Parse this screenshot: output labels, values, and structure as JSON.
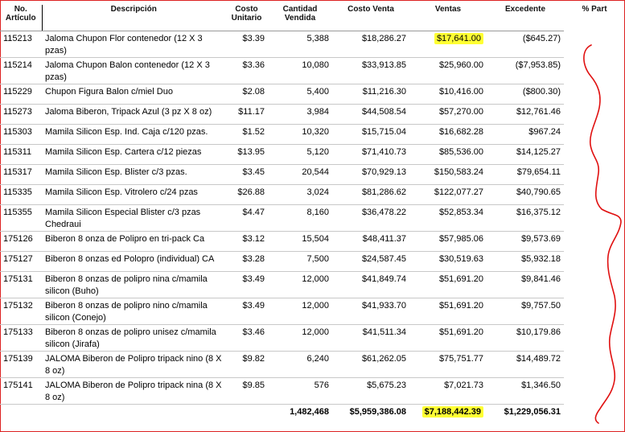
{
  "columns": {
    "no_articulo": "No. Artículo",
    "descripcion": "Descripción",
    "costo_unitario": "Costo Unitario",
    "cantidad_vendida": "Cantidad Vendida",
    "costo_venta": "Costo Venta",
    "ventas": "Ventas",
    "excedente": "Excedente",
    "pct_part": "% Part"
  },
  "rows": [
    {
      "code": "115213",
      "desc": "Jaloma Chupon Flor contenedor (12 X 3 pzas)",
      "unit": "$3.39",
      "qty": "5,388",
      "cost": "$18,286.27",
      "sales": "$17,641.00",
      "excess": "($645.27)",
      "highlight": true
    },
    {
      "code": "115214",
      "desc": "Jaloma Chupon Balon contenedor (12 X 3 pzas)",
      "unit": "$3.36",
      "qty": "10,080",
      "cost": "$33,913.85",
      "sales": "$25,960.00",
      "excess": "($7,953.85)"
    },
    {
      "code": "115229",
      "desc": "Chupon Figura Balon c/miel Duo",
      "unit": "$2.08",
      "qty": "5,400",
      "cost": "$11,216.30",
      "sales": "$10,416.00",
      "excess": "($800.30)"
    },
    {
      "code": "115273",
      "desc": "Jaloma Biberon, Tripack Azul (3 pz X 8 oz)",
      "unit": "$11.17",
      "qty": "3,984",
      "cost": "$44,508.54",
      "sales": "$57,270.00",
      "excess": "$12,761.46"
    },
    {
      "code": "115303",
      "desc": "Mamila Silicon Esp. Ind. Caja c/120 pzas.",
      "unit": "$1.52",
      "qty": "10,320",
      "cost": "$15,715.04",
      "sales": "$16,682.28",
      "excess": "$967.24"
    },
    {
      "code": "115311",
      "desc": "Mamila Silicon Esp. Cartera c/12 piezas",
      "unit": "$13.95",
      "qty": "5,120",
      "cost": "$71,410.73",
      "sales": "$85,536.00",
      "excess": "$14,125.27"
    },
    {
      "code": "115317",
      "desc": "Mamila Silicon Esp. Blister c/3 pzas.",
      "unit": "$3.45",
      "qty": "20,544",
      "cost": "$70,929.13",
      "sales": "$150,583.24",
      "excess": "$79,654.11"
    },
    {
      "code": "115335",
      "desc": "Mamila Silicon Esp. Vitrolero c/24 pzas",
      "unit": "$26.88",
      "qty": "3,024",
      "cost": "$81,286.62",
      "sales": "$122,077.27",
      "excess": "$40,790.65"
    },
    {
      "code": "115355",
      "desc": "Mamila Silicon Especial Blister c/3 pzas Chedraui",
      "unit": "$4.47",
      "qty": "8,160",
      "cost": "$36,478.22",
      "sales": "$52,853.34",
      "excess": "$16,375.12"
    },
    {
      "code": "175126",
      "desc": "Biberon 8 onza de Polipro en tri-pack Ca",
      "unit": "$3.12",
      "qty": "15,504",
      "cost": "$48,411.37",
      "sales": "$57,985.06",
      "excess": "$9,573.69"
    },
    {
      "code": "175127",
      "desc": "Biberon 8 onzas ed Polopro (individual) CA",
      "unit": "$3.28",
      "qty": "7,500",
      "cost": "$24,587.45",
      "sales": "$30,519.63",
      "excess": "$5,932.18"
    },
    {
      "code": "175131",
      "desc": "Biberon 8 onzas de polipro nina c/mamila silicon (Buho)",
      "unit": "$3.49",
      "qty": "12,000",
      "cost": "$41,849.74",
      "sales": "$51,691.20",
      "excess": "$9,841.46"
    },
    {
      "code": "175132",
      "desc": "Biberon 8 onzas de polipro nino c/mamila silicon (Conejo)",
      "unit": "$3.49",
      "qty": "12,000",
      "cost": "$41,933.70",
      "sales": "$51,691.20",
      "excess": "$9,757.50"
    },
    {
      "code": "175133",
      "desc": "Biberon 8 onzas de polipro unisez c/mamila silicon (Jirafa)",
      "unit": "$3.46",
      "qty": "12,000",
      "cost": "$41,511.34",
      "sales": "$51,691.20",
      "excess": "$10,179.86"
    },
    {
      "code": "175139",
      "desc": "JALOMA Biberon de Polipro tripack nino (8 X 8 oz)",
      "unit": "$9.82",
      "qty": "6,240",
      "cost": "$61,262.05",
      "sales": "$75,751.77",
      "excess": "$14,489.72"
    },
    {
      "code": "175141",
      "desc": "JALOMA Biberon de Polipro tripack nina (8 X 8 oz)",
      "unit": "$9.85",
      "qty": "576",
      "cost": "$5,675.23",
      "sales": "$7,021.73",
      "excess": "$1,346.50"
    }
  ],
  "totals": {
    "qty": "1,482,468",
    "cost": "$5,959,386.08",
    "sales": "$7,188,442.39",
    "excess": "$1,229,056.31"
  },
  "colors": {
    "highlight": "#ffff33",
    "annotation": "#e01010",
    "frame": "#dd2222"
  }
}
